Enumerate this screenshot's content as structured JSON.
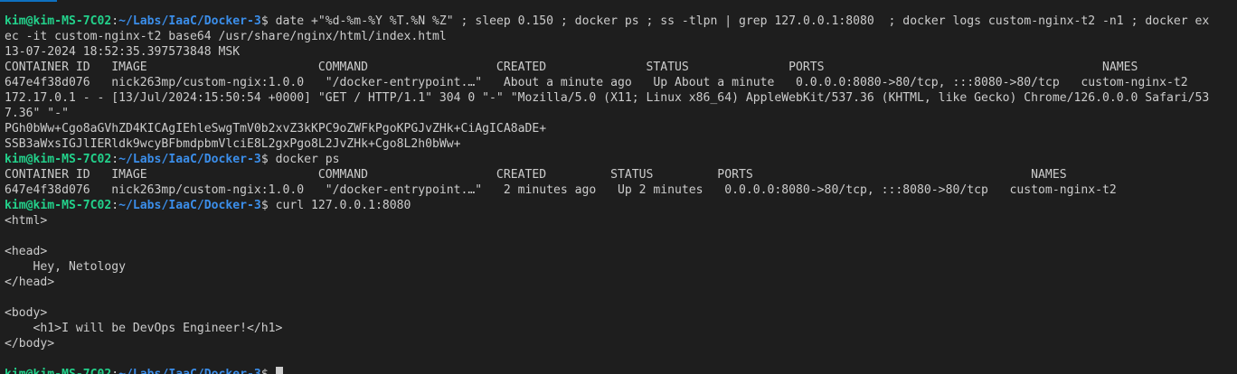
{
  "terminal": {
    "user_host": "kim@kim-MS-7C02",
    "path": "~/Labs/IaaC/Docker-3",
    "prompt_sep": ":",
    "prompt_end": "$ ",
    "colors": {
      "background": "#1e1e1e",
      "text": "#cccccc",
      "user_host": "#23d18b",
      "path": "#3b8eea"
    },
    "commands": [
      "date +\"%d-%m-%Y %T.%N %Z\" ; sleep 0.150 ; docker ps ; ss -tlpn | grep 127.0.0.1:8080  ; docker logs custom-nginx-t2 -n1 ; docker ex",
      "docker ps",
      "curl 127.0.0.1:8080",
      ""
    ],
    "outputs": {
      "cmd1_wrap": "ec -it custom-nginx-t2 base64 /usr/share/nginx/html/index.html",
      "date": "13-07-2024 18:52:35.397573848 MSK",
      "ps1_header": "CONTAINER ID   IMAGE                        COMMAND                  CREATED              STATUS              PORTS                                       NAMES",
      "ps1_row": "647e4f38d076   nick263mp/custom-ngix:1.0.0   \"/docker-entrypoint.…\"   About a minute ago   Up About a minute   0.0.0.0:8080->80/tcp, :::8080->80/tcp   custom-nginx-t2",
      "log_line": "172.17.0.1 - - [13/Jul/2024:15:50:54 +0000] \"GET / HTTP/1.1\" 304 0 \"-\" \"Mozilla/5.0 (X11; Linux x86_64) AppleWebKit/537.36 (KHTML, like Gecko) Chrome/126.0.0.0 Safari/53",
      "log_wrap": "7.36\" \"-\"",
      "base64_1": "PGh0bWw+Cgo8aGVhZD4KICAgIEhleSwgTmV0b2xvZ3kKPC9oZWFkPgoKPGJvZHk+CiAgICA8aDE+",
      "base64_2": "SSB3aWxsIGJlIERldk9wcyBFbmdpbmVlciE8L2gxPgo8L2JvZHk+Cgo8L2h0bWw+",
      "ps2_header": "CONTAINER ID   IMAGE                        COMMAND                  CREATED         STATUS         PORTS                                       NAMES",
      "ps2_row": "647e4f38d076   nick263mp/custom-ngix:1.0.0   \"/docker-entrypoint.…\"   2 minutes ago   Up 2 minutes   0.0.0.0:8080->80/tcp, :::8080->80/tcp   custom-nginx-t2",
      "html": [
        "<html>",
        "",
        "<head>",
        "    Hey, Netology",
        "</head>",
        "",
        "<body>",
        "    <h1>I will be DevOps Engineer!</h1>",
        "</body>",
        ""
      ]
    }
  }
}
